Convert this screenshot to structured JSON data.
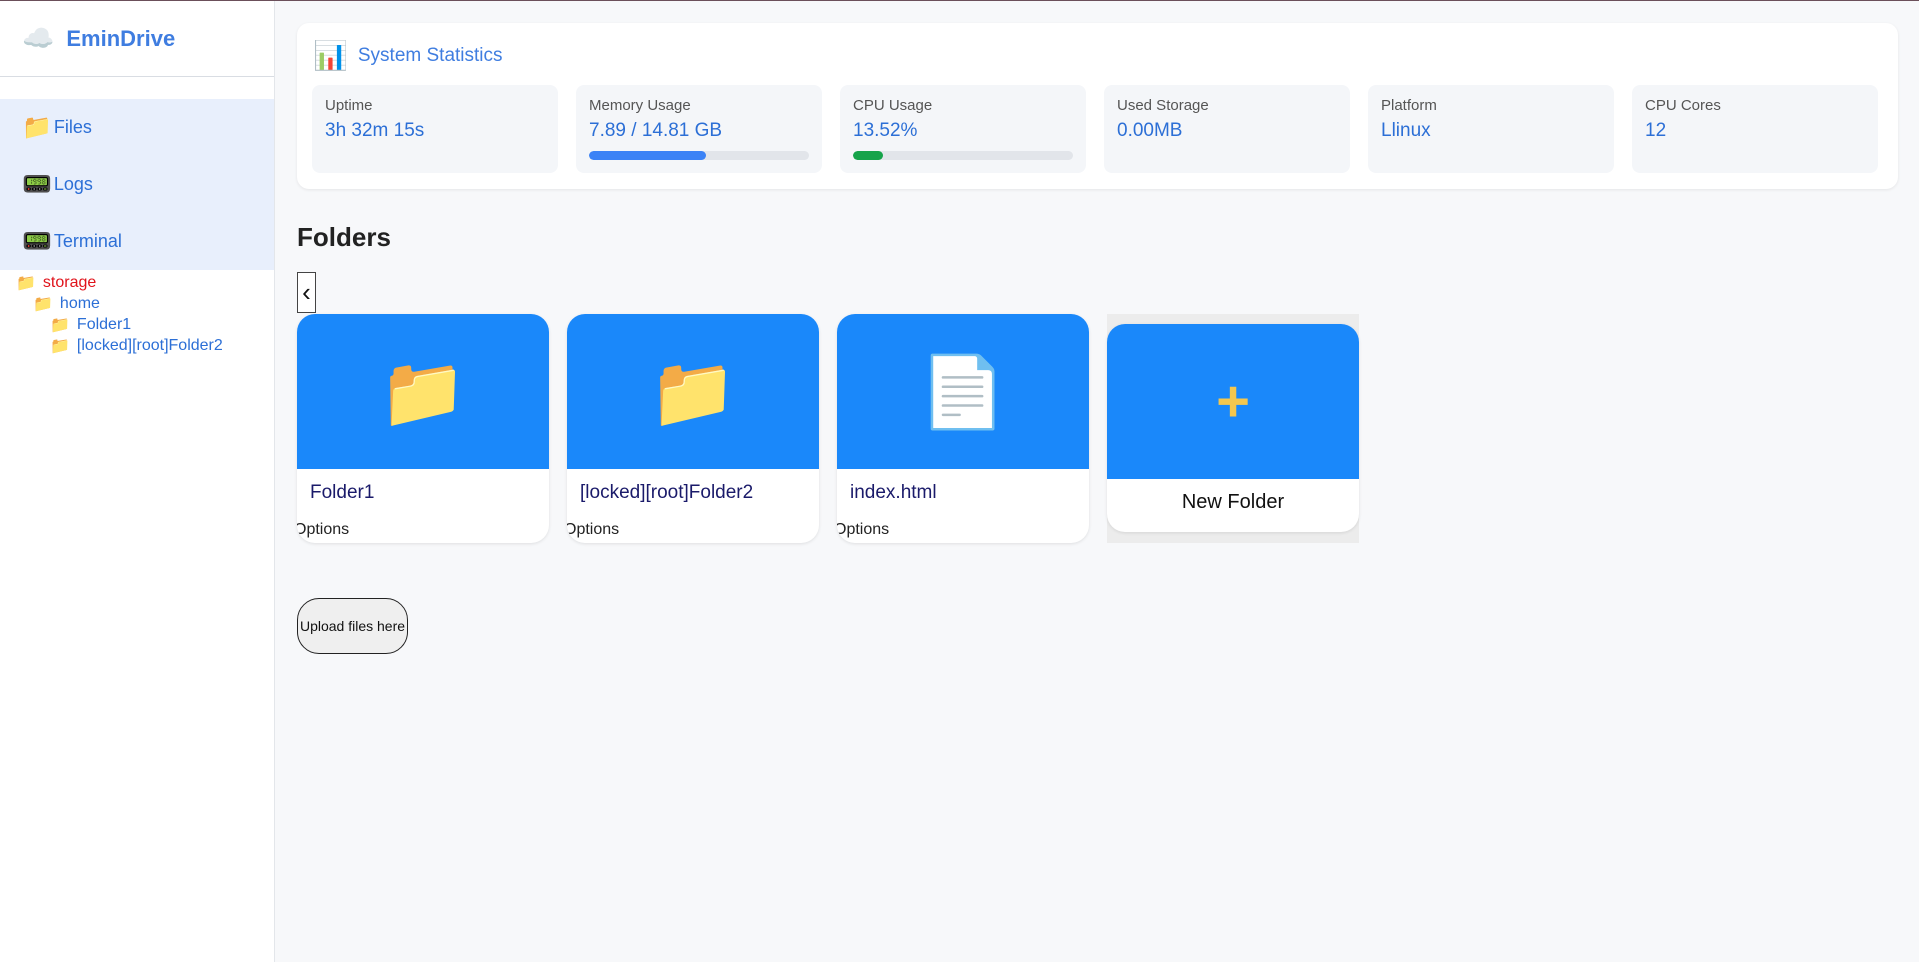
{
  "app": {
    "name": "EminDrive",
    "logo_icon": "☁️"
  },
  "sidebar": {
    "nav": [
      {
        "icon": "📁",
        "label": "Files"
      },
      {
        "icon": "📟",
        "label": "Logs"
      },
      {
        "icon": "📟",
        "label": "Terminal"
      }
    ],
    "tree": {
      "root": "storage",
      "home": "home",
      "children": [
        "Folder1",
        "[locked][root]Folder2"
      ],
      "folder_icon": "📁"
    }
  },
  "stats": {
    "title": "System Statistics",
    "icon": "📊",
    "items": [
      {
        "label": "Uptime",
        "value": "3h 32m 15s"
      },
      {
        "label": "Memory Usage",
        "value": "7.89 / 14.81 GB",
        "progress_percent": 53.3,
        "color": "#3b82f6"
      },
      {
        "label": "CPU Usage",
        "value": "13.52%",
        "progress_percent": 13.52,
        "color": "#16a34a"
      },
      {
        "label": "Used Storage",
        "value": "0.00MB"
      },
      {
        "label": "Platform",
        "value": "Llinux"
      },
      {
        "label": "CPU Cores",
        "value": "12"
      }
    ]
  },
  "folders": {
    "title": "Folders",
    "back_label": "‹",
    "items": [
      {
        "icon": "📁",
        "name": "Folder1",
        "options": "Options"
      },
      {
        "icon": "📁",
        "name": "[locked][root]Folder2",
        "options": "Options"
      },
      {
        "icon": "📄",
        "name": "index.html",
        "options": "Options"
      }
    ],
    "new_folder": {
      "icon": "+",
      "label": "New Folder"
    }
  },
  "upload": {
    "label": "Upload files here"
  },
  "colors": {
    "accent": "#3f7de0",
    "card_blue": "#1a88fa",
    "root_red": "#e0131b"
  }
}
